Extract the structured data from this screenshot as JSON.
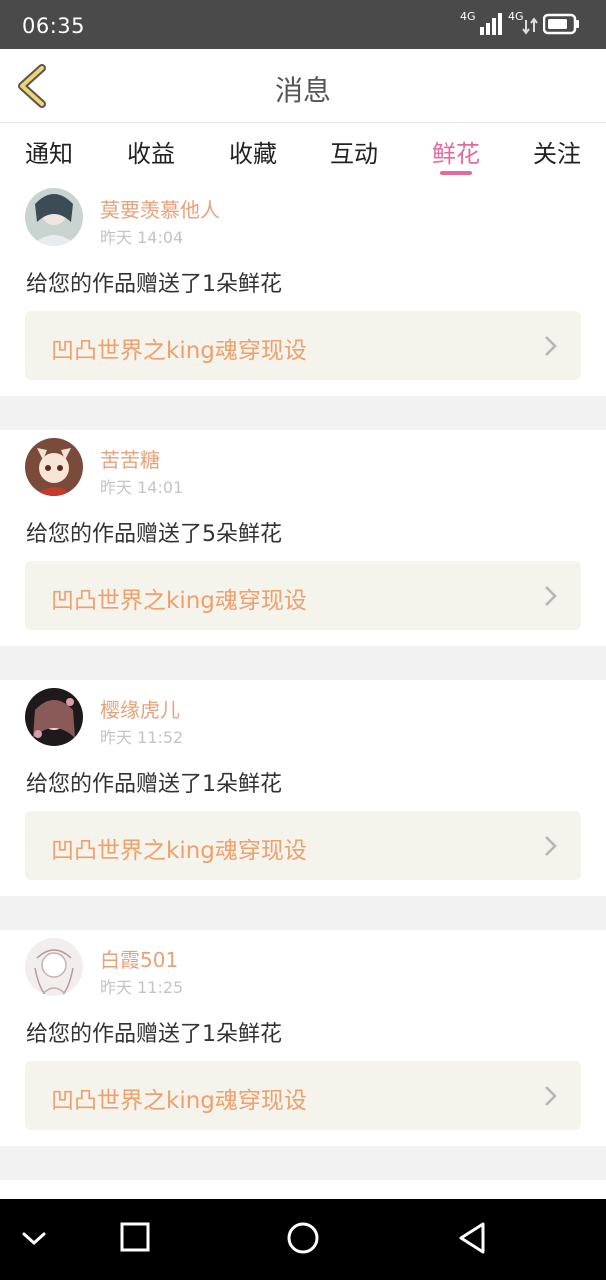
{
  "status_bar": {
    "time": "06:35",
    "net1": "4G",
    "net2": "4G"
  },
  "header": {
    "title": "消息",
    "back_icon": "chevron-left-icon"
  },
  "tabs": [
    {
      "label": "通知",
      "active": false
    },
    {
      "label": "收益",
      "active": false
    },
    {
      "label": "收藏",
      "active": false
    },
    {
      "label": "互动",
      "active": false
    },
    {
      "label": "鲜花",
      "active": true
    },
    {
      "label": "关注",
      "active": false
    }
  ],
  "messages": [
    {
      "user": "莫要羡慕他人",
      "time": "昨天 14:04",
      "text": "给您的作品赠送了1朵鲜花",
      "work": "凹凸世界之king魂穿现设"
    },
    {
      "user": "苦苦糖",
      "time": "昨天 14:01",
      "text": "给您的作品赠送了5朵鲜花",
      "work": "凹凸世界之king魂穿现设"
    },
    {
      "user": "樱缘虎儿",
      "time": "昨天 11:52",
      "text": "给您的作品赠送了1朵鲜花",
      "work": "凹凸世界之king魂穿现设"
    },
    {
      "user": "白霞501",
      "time": "昨天 11:25",
      "text": "给您的作品赠送了1朵鲜花",
      "work": "凹凸世界之king魂穿现设"
    }
  ],
  "colors": {
    "accent": "#e36a9a",
    "username": "#e8a27a",
    "work_title": "#f0a06a",
    "work_bg": "#f4f3ec",
    "status_bar": "#4a4a4a"
  },
  "nav_bar": {
    "icons": [
      "chevron-down-icon",
      "square-icon",
      "circle-icon",
      "triangle-back-icon"
    ]
  }
}
